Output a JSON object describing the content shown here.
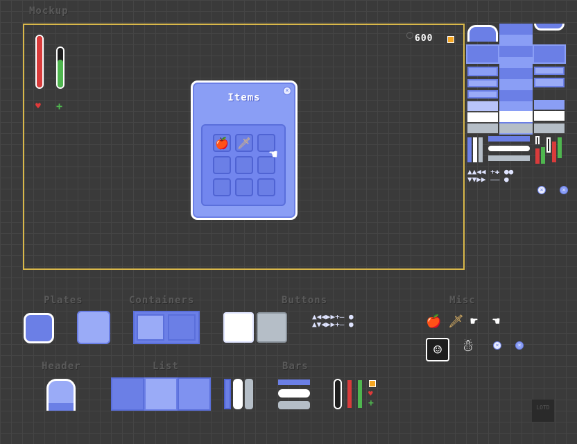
{
  "labels": {
    "mockup": "Mockup",
    "plates": "Plates",
    "containers": "Containers",
    "buttons": "Buttons",
    "misc": "Misc",
    "header": "Header",
    "list": "List",
    "bars": "Bars"
  },
  "hud": {
    "currency_value": "600",
    "health_level": 1.0,
    "stamina_level": 0.7,
    "health_icon": "heart-icon",
    "stamina_icon": "plus-icon"
  },
  "items_panel": {
    "title": "Items",
    "slots": [
      {
        "icon": "apple-icon",
        "glyph": "🍎"
      },
      {
        "icon": "sword-icon",
        "glyph": "🗡"
      },
      {
        "icon": "",
        "glyph": ""
      },
      {
        "icon": "",
        "glyph": ""
      },
      {
        "icon": "",
        "glyph": ""
      },
      {
        "icon": "",
        "glyph": ""
      },
      {
        "icon": "",
        "glyph": ""
      },
      {
        "icon": "",
        "glyph": ""
      },
      {
        "icon": "",
        "glyph": ""
      }
    ]
  },
  "colors": {
    "accent": "#6b7fe6",
    "accent_light": "#9aabf7",
    "frame": "#d9b84a",
    "health": "#d93b3b",
    "stamina": "#4fb64f",
    "coin": "#f5a623",
    "gray_button": "#b5bec7"
  },
  "logo": {
    "text": "LOTD"
  }
}
